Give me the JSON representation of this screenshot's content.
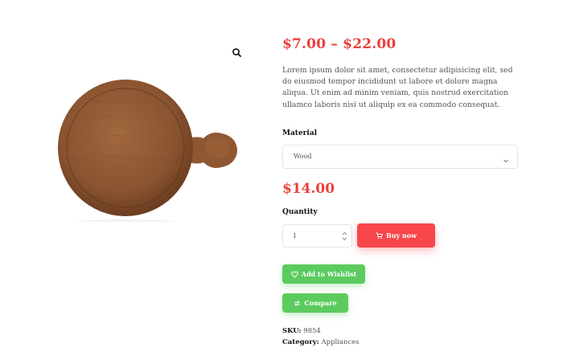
{
  "product": {
    "price_range": "$7.00 – $22.00",
    "description": "Lorem ipsum dolor sit amet, consectetur adipisicing elit, sed do eiusmod tempor incididunt ut labore et dolore magna aliqua. Ut enim ad minim veniam, quis nostrud exercitation ullamco laboris nisi ut aliquip ex ea commodo consequat.",
    "variation_price": "$14.00"
  },
  "material": {
    "label": "Material",
    "selected": "Wood"
  },
  "quantity": {
    "label": "Quantity",
    "value": "1"
  },
  "actions": {
    "buy_now": "Buy now",
    "wishlist": "Add to Wishlist",
    "compare": "Compare"
  },
  "meta": {
    "sku_label": "SKU:",
    "sku_value": "9854",
    "category_label": "Category:",
    "category_value": "Appliances"
  },
  "colors": {
    "price": "#e8413b",
    "buy_button": "#f8464a",
    "secondary_buttons": "#5ccb5f"
  },
  "icons": {
    "zoom": "search-icon",
    "select": "chevron-down-icon",
    "buy": "cart-icon",
    "wishlist": "heart-icon",
    "compare": "compare-arrows-icon"
  }
}
